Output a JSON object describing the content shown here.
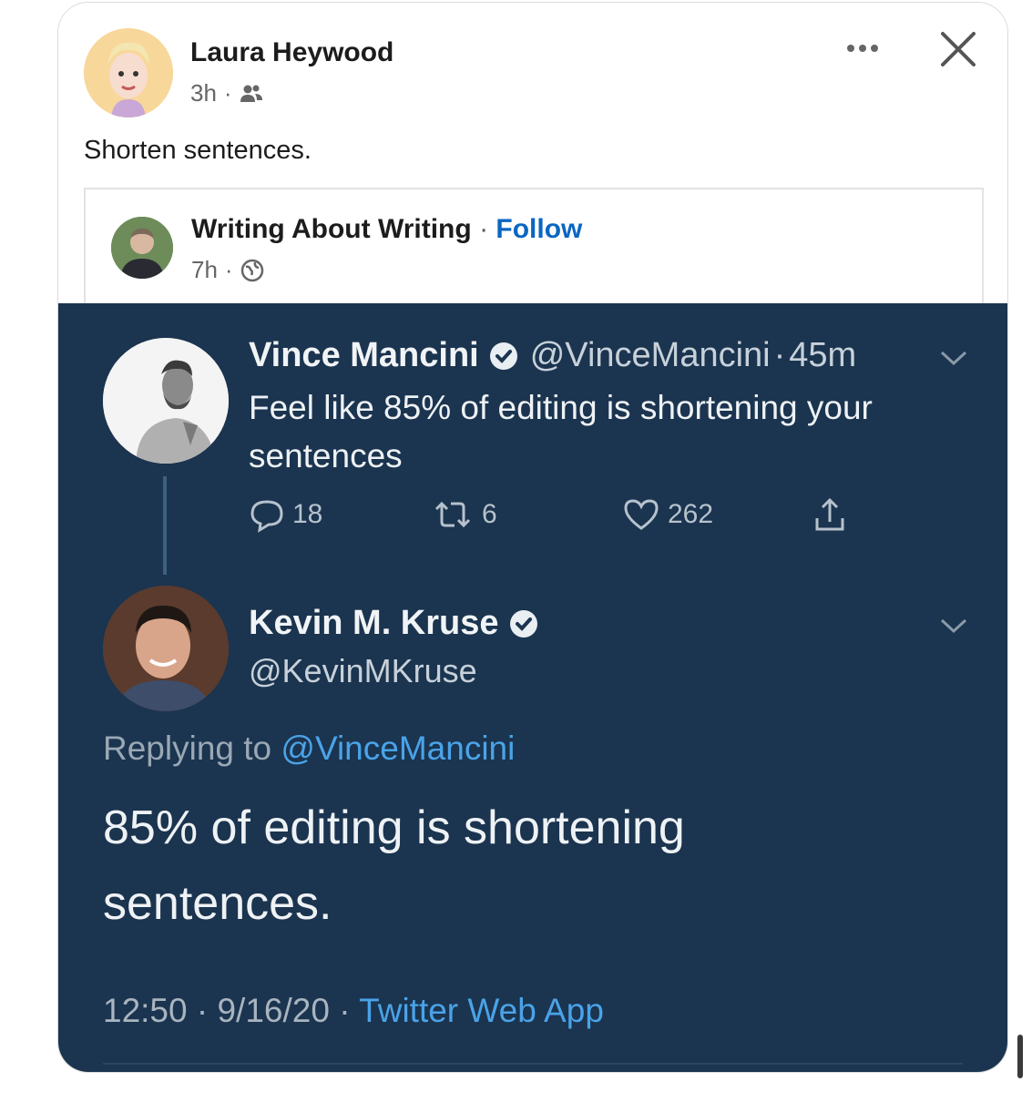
{
  "post": {
    "author": "Laura Heywood",
    "time": "3h",
    "separator": "·",
    "audience_icon": "friends-icon",
    "text": "Shorten sentences."
  },
  "shared": {
    "page_name": "Writing About Writing",
    "dot": "·",
    "follow_label": "Follow",
    "time": "7h",
    "separator": "·",
    "audience_icon": "globe-icon"
  },
  "tweet1": {
    "name": "Vince Mancini",
    "handle": "@VinceMancini",
    "sep": "·",
    "time": "45m",
    "text": "Feel like 85% of editing is shortening your sentences",
    "replies": "18",
    "retweets": "6",
    "likes": "262"
  },
  "tweet2": {
    "name": "Kevin M. Kruse",
    "handle": "@KevinMKruse",
    "replying_prefix": "Replying to",
    "replying_to": "@VinceMancini",
    "text": "85% of editing is shortening sentences.",
    "time": "12:50",
    "dot1": "·",
    "date": "9/16/20",
    "dot2": "·",
    "source": "Twitter Web App"
  },
  "colors": {
    "tweet_bg": "#1b344f",
    "link_blue": "#0a66c2",
    "twitter_blue": "#4aa3e8"
  }
}
